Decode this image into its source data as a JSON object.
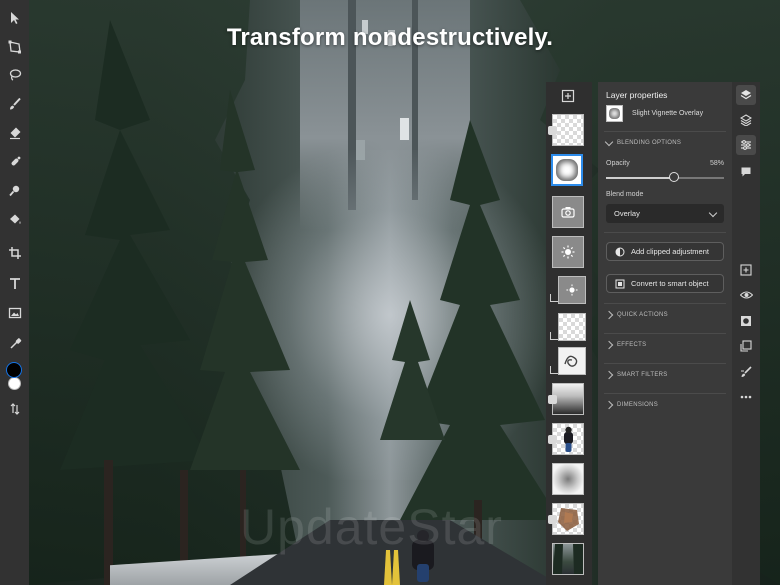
{
  "headline": "Transform nondestructively.",
  "watermark": "UpdateStar",
  "toolbar": {
    "tools": [
      "select-icon",
      "transform-icon",
      "lasso-icon",
      "brush-icon",
      "eraser-icon",
      "healing-icon",
      "clone-stamp-icon",
      "paint-bucket-icon",
      "crop-icon",
      "type-icon",
      "place-image-icon",
      "eyedropper-icon"
    ],
    "foreground_color": "#000000",
    "background_color": "#ffffff"
  },
  "layers": {
    "add_label": "+",
    "thumbs": [
      {
        "kind": "checker",
        "linked": true
      },
      {
        "kind": "vignette",
        "selected": true
      },
      {
        "kind": "camera"
      },
      {
        "kind": "adjustment"
      },
      {
        "kind": "adjustment",
        "clipped": true
      },
      {
        "kind": "checker",
        "clipped": true
      },
      {
        "kind": "scribble",
        "clipped": true
      },
      {
        "kind": "gradient",
        "linked": true
      },
      {
        "kind": "rider",
        "linked": true
      },
      {
        "kind": "blur"
      },
      {
        "kind": "texture",
        "linked": true
      },
      {
        "kind": "road"
      }
    ]
  },
  "properties": {
    "title": "Layer properties",
    "layer_name": "Slight Vignette Overlay",
    "blending_header": "BLENDING OPTIONS",
    "opacity_label": "Opacity",
    "opacity_value": "58%",
    "opacity_fraction": 0.58,
    "blend_mode_label": "Blend mode",
    "blend_mode_value": "Overlay",
    "add_clipped_adjustment": "Add clipped adjustment",
    "convert_smart_object": "Convert to smart object",
    "quick_actions": "QUICK ACTIONS",
    "effects": "EFFECTS",
    "smart_filters": "SMART FILTERS",
    "dimensions": "DIMENSIONS"
  },
  "rail": [
    "layers-icon",
    "layer-properties-icon",
    "adjustments-icon",
    "comments-icon",
    "add-layer-icon",
    "visibility-icon",
    "mask-icon",
    "clip-icon",
    "brush-mask-icon",
    "more-icon"
  ],
  "accent_color": "#2d8ceb"
}
